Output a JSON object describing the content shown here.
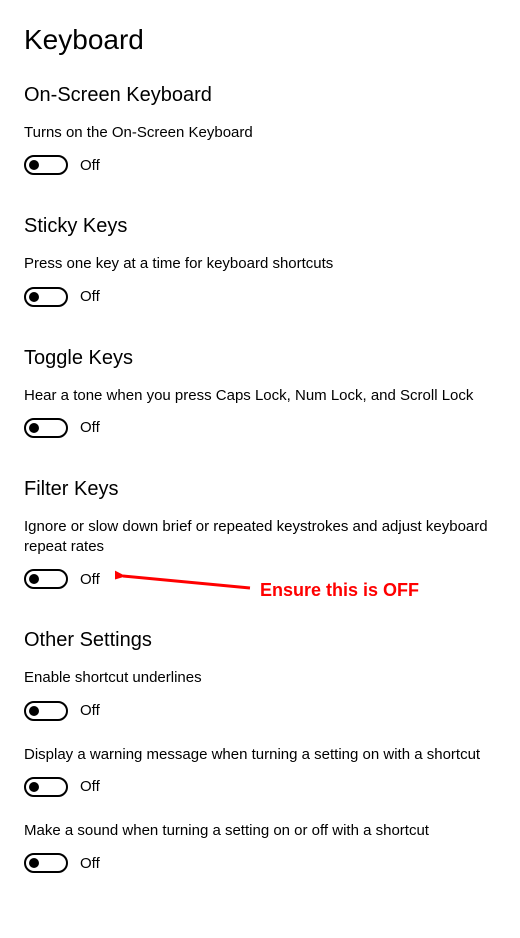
{
  "page_title": "Keyboard",
  "sections": {
    "on_screen_keyboard": {
      "heading": "On-Screen Keyboard",
      "description": "Turns on the On-Screen Keyboard",
      "toggle_label": "Off",
      "toggle_state": "off"
    },
    "sticky_keys": {
      "heading": "Sticky Keys",
      "description": "Press one key at a time for keyboard shortcuts",
      "toggle_label": "Off",
      "toggle_state": "off"
    },
    "toggle_keys": {
      "heading": "Toggle Keys",
      "description": "Hear a tone when you press Caps Lock, Num Lock, and Scroll Lock",
      "toggle_label": "Off",
      "toggle_state": "off"
    },
    "filter_keys": {
      "heading": "Filter Keys",
      "description": "Ignore or slow down brief or repeated keystrokes and adjust keyboard repeat rates",
      "toggle_label": "Off",
      "toggle_state": "off"
    },
    "other_settings": {
      "heading": "Other Settings",
      "items": [
        {
          "description": "Enable shortcut underlines",
          "toggle_label": "Off",
          "toggle_state": "off"
        },
        {
          "description": "Display a warning message when turning a setting on with a shortcut",
          "toggle_label": "Off",
          "toggle_state": "off"
        },
        {
          "description": "Make a sound when turning a setting on or off with a shortcut",
          "toggle_label": "Off",
          "toggle_state": "off"
        }
      ]
    }
  },
  "annotation": {
    "text": "Ensure this is OFF",
    "color": "#ff0000"
  }
}
